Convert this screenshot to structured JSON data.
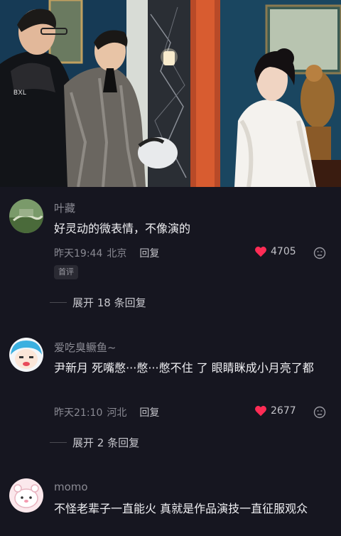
{
  "video": {
    "watermark": "BXL"
  },
  "comments": [
    {
      "username": "叶藏",
      "text": "好灵动的微表情，不像演的",
      "time": "昨天19:44",
      "location": "北京",
      "reply_label": "回复",
      "likes": "4705",
      "badge": "首评",
      "expand_label": "展开 18 条回复",
      "avatar_icon": "landscape-avatar"
    },
    {
      "username": "爱吃臭鳜鱼~",
      "text": "尹新月 死嘴憋···憋···憋不住 了 眼睛眯成小月亮了都",
      "time": "昨天21:10",
      "location": "河北",
      "reply_label": "回复",
      "likes": "2677",
      "expand_label": "展开 2 条回复",
      "avatar_icon": "cartoon-blue-hair-avatar"
    },
    {
      "username": "momo",
      "text": "不怪老辈子一直能火 真就是作品演技一直征服观众",
      "avatar_icon": "cartoon-pink-avatar"
    }
  ],
  "colors": {
    "background": "#161620",
    "like_heart": "#fe2c55",
    "username": "#8a8a93",
    "text": "#f0f0f3"
  }
}
